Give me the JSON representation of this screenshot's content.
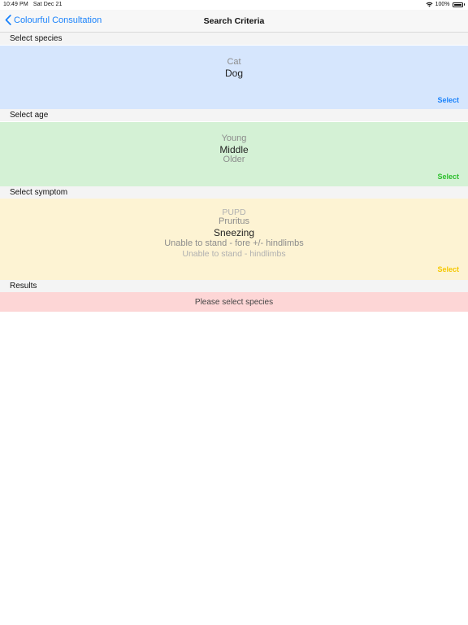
{
  "status_bar": {
    "time": "10:49 PM",
    "date": "Sat Dec 21",
    "battery": "100%"
  },
  "nav": {
    "back_label": "Colourful Consultation",
    "title": "Search Criteria"
  },
  "sections": {
    "species": {
      "header": "Select species",
      "options": [
        "Cat",
        "Dog"
      ],
      "selected": "Dog",
      "select_label": "Select",
      "background": "#d6e6fd",
      "accent": "#1a82fb"
    },
    "age": {
      "header": "Select age",
      "options": [
        "Young",
        "Middle",
        "Older"
      ],
      "selected": "Middle",
      "select_label": "Select",
      "background": "#d4f1d5",
      "accent": "#2cbf2c"
    },
    "symptom": {
      "header": "Select symptom",
      "options": [
        "PUPD",
        "Pruritus",
        "Sneezing",
        "Unable to stand - fore +/- hindlimbs",
        "Unable to stand - hindlimbs"
      ],
      "selected": "Sneezing",
      "select_label": "Select",
      "background": "#fdf3d3",
      "accent": "#f5c800"
    },
    "results": {
      "header": "Results",
      "message": "Please select species",
      "background": "#fdd6d6"
    }
  }
}
